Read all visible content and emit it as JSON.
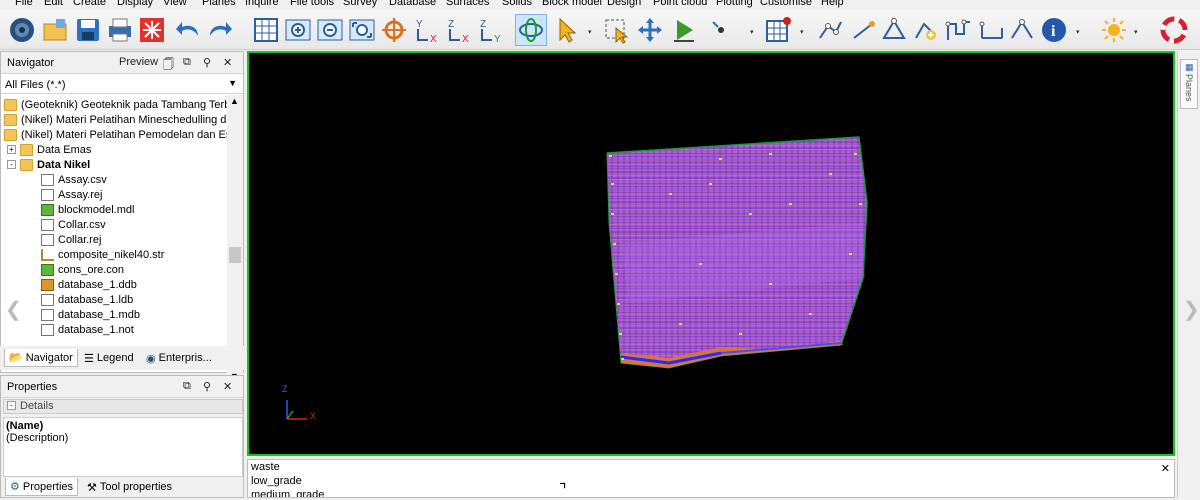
{
  "menu": [
    "File",
    "Edit",
    "Create",
    "Display",
    "View",
    "Planes",
    "Inquire",
    "File tools",
    "Survey",
    "Database",
    "Surfaces",
    "Solids",
    "Block model",
    "Design",
    "Point cloud",
    "Plotting",
    "Customise",
    "Help"
  ],
  "toolbar": {
    "icons": [
      "globe-icon",
      "open-folder-icon",
      "save-icon",
      "print-icon",
      "close-red-icon",
      "undo-icon",
      "redo-icon",
      "grid-icon",
      "zoom-in-icon",
      "zoom-out-icon",
      "zoom-fit-icon",
      "target-icon",
      "yx-axis-icon",
      "zx-axis-icon",
      "zy-axis-icon",
      "orbit-icon",
      "select-arrow-icon",
      "select-box-icon",
      "move-icon",
      "play-icon",
      "grid-toggle-icon",
      "digitize-icon",
      "info-icon",
      "sun-icon",
      "lifebuoy-icon"
    ]
  },
  "navigator": {
    "title": "Navigator",
    "preview_label": "Preview",
    "filter": "All Files (*.*)",
    "items": [
      {
        "label": "(Geoteknik) Geoteknik pada Tambang Terbuka",
        "type": "folder",
        "level": 0
      },
      {
        "label": "(Nikel) Materi Pelatihan Mineschedulling dan M",
        "type": "folder",
        "level": 0
      },
      {
        "label": "(Nikel) Materi Pelatihan Pemodelan dan Estima",
        "type": "folder",
        "level": 0
      },
      {
        "label": "Data Emas",
        "type": "folder",
        "level": 1,
        "expander": "+"
      },
      {
        "label": "Data Nikel",
        "type": "folder-open",
        "level": 1,
        "expander": "-",
        "bold": true
      },
      {
        "label": "Assay.csv",
        "type": "doc",
        "level": 2
      },
      {
        "label": "Assay.rej",
        "type": "doc",
        "level": 2
      },
      {
        "label": "blockmodel.mdl",
        "type": "cube",
        "level": 2
      },
      {
        "label": "Collar.csv",
        "type": "doc",
        "level": 2
      },
      {
        "label": "Collar.rej",
        "type": "doc",
        "level": 2
      },
      {
        "label": "composite_nikel40.str",
        "type": "string",
        "level": 2
      },
      {
        "label": "cons_ore.con",
        "type": "cube",
        "level": 2
      },
      {
        "label": "database_1.ddb",
        "type": "db",
        "level": 2
      },
      {
        "label": "database_1.ldb",
        "type": "doc",
        "level": 2
      },
      {
        "label": "database_1.mdb",
        "type": "doc",
        "level": 2
      },
      {
        "label": "database_1.not",
        "type": "doc",
        "level": 2
      }
    ],
    "tabs": [
      "Navigator",
      "Legend",
      "Enterpris..."
    ]
  },
  "properties": {
    "title": "Properties",
    "section": "Details",
    "name_label": "(Name)",
    "description_label": "(Description)",
    "tabs": [
      "Properties",
      "Tool properties"
    ]
  },
  "viewport": {
    "axis_z": "Z",
    "axis_x": "X",
    "border_color": "#17c417"
  },
  "right_panel": {
    "planes_label": "Planes"
  },
  "legend_list": [
    "waste",
    "low_grade",
    "medium_grade"
  ]
}
